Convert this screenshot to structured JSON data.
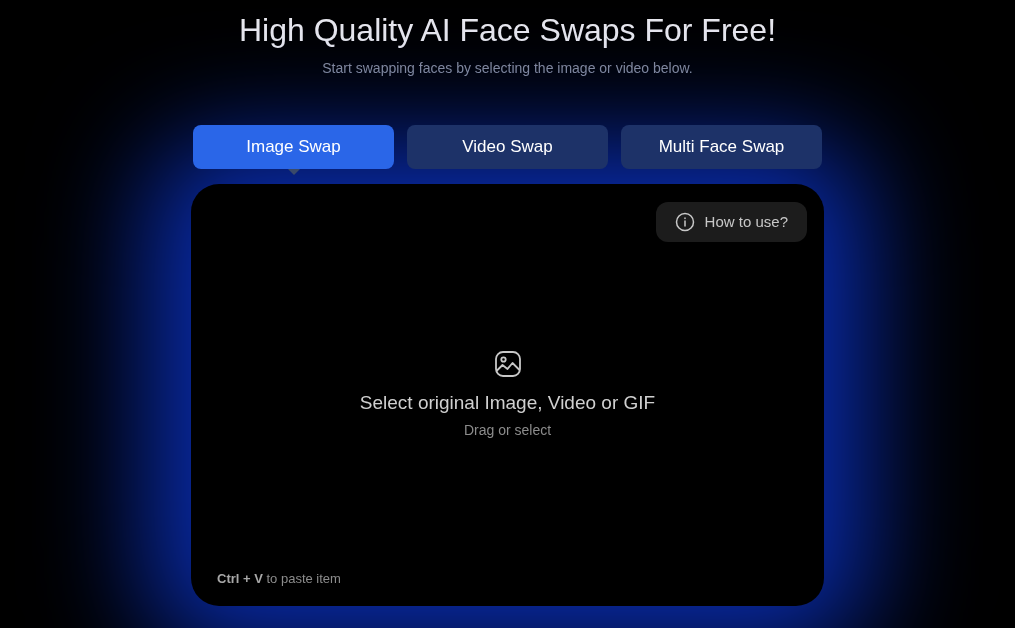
{
  "heading": {
    "title": "High Quality AI Face Swaps For Free!",
    "subtitle": "Start swapping faces by selecting the image or video below."
  },
  "tabs": [
    {
      "label": "Image Swap",
      "selected": true
    },
    {
      "label": "Video Swap",
      "selected": false
    },
    {
      "label": "Multi Face Swap",
      "selected": false
    }
  ],
  "dropzone": {
    "help_button": "How to use?",
    "prompt": "Select original Image, Video or GIF",
    "hint": "Drag or select",
    "paste_hint": "**Ctrl + V** to paste item"
  }
}
